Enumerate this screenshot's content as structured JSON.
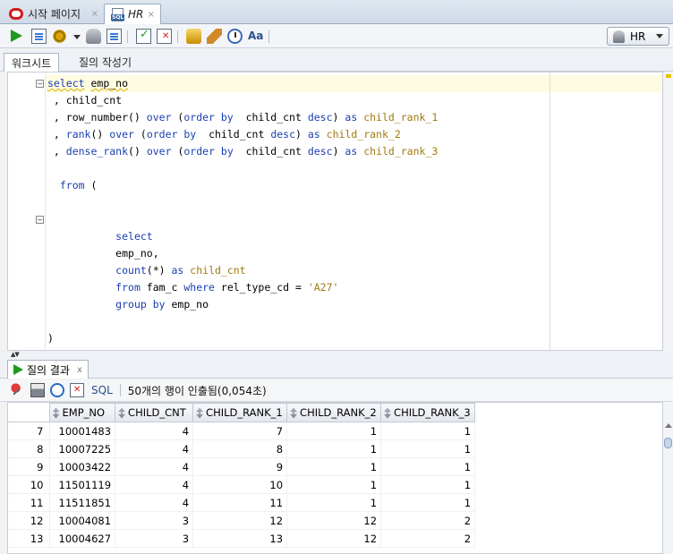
{
  "tabs": [
    {
      "label": "시작 페이지",
      "close": "×"
    },
    {
      "label": "HR",
      "close": "×"
    }
  ],
  "connection": {
    "label": "HR"
  },
  "subtabs": [
    "워크시트",
    "질의 작성기"
  ],
  "editor": {
    "lines": [
      [
        {
          "t": "select",
          "c": "kw squig"
        },
        {
          "t": " ",
          "c": "plain"
        },
        {
          "t": "emp_no",
          "c": "plain squig"
        }
      ],
      [
        {
          "t": " , child_cnt",
          "c": "plain"
        }
      ],
      [
        {
          "t": " , row_number() ",
          "c": "plain"
        },
        {
          "t": "over",
          "c": "kw"
        },
        {
          "t": " (",
          "c": "plain"
        },
        {
          "t": "order by",
          "c": "kw"
        },
        {
          "t": "  child_cnt ",
          "c": "plain"
        },
        {
          "t": "desc",
          "c": "kw"
        },
        {
          "t": ") ",
          "c": "plain"
        },
        {
          "t": "as",
          "c": "kw"
        },
        {
          "t": " ",
          "c": "plain"
        },
        {
          "t": "child_rank_1",
          "c": "id"
        }
      ],
      [
        {
          "t": " , ",
          "c": "plain"
        },
        {
          "t": "rank",
          "c": "kw"
        },
        {
          "t": "() ",
          "c": "plain"
        },
        {
          "t": "over",
          "c": "kw"
        },
        {
          "t": " (",
          "c": "plain"
        },
        {
          "t": "order by",
          "c": "kw"
        },
        {
          "t": "  child_cnt ",
          "c": "plain"
        },
        {
          "t": "desc",
          "c": "kw"
        },
        {
          "t": ") ",
          "c": "plain"
        },
        {
          "t": "as",
          "c": "kw"
        },
        {
          "t": " ",
          "c": "plain"
        },
        {
          "t": "child_rank_2",
          "c": "id"
        }
      ],
      [
        {
          "t": " , ",
          "c": "plain"
        },
        {
          "t": "dense_rank",
          "c": "kw"
        },
        {
          "t": "() ",
          "c": "plain"
        },
        {
          "t": "over",
          "c": "kw"
        },
        {
          "t": " (",
          "c": "plain"
        },
        {
          "t": "order by",
          "c": "kw"
        },
        {
          "t": "  child_cnt ",
          "c": "plain"
        },
        {
          "t": "desc",
          "c": "kw"
        },
        {
          "t": ") ",
          "c": "plain"
        },
        {
          "t": "as",
          "c": "kw"
        },
        {
          "t": " ",
          "c": "plain"
        },
        {
          "t": "child_rank_3",
          "c": "id"
        }
      ],
      [],
      [
        {
          "t": "  ",
          "c": "plain"
        },
        {
          "t": "from",
          "c": "kw"
        },
        {
          "t": " (",
          "c": "plain"
        }
      ],
      [],
      [],
      [
        {
          "t": "           ",
          "c": "plain"
        },
        {
          "t": "select",
          "c": "kw"
        }
      ],
      [
        {
          "t": "           emp_no,",
          "c": "plain"
        }
      ],
      [
        {
          "t": "           ",
          "c": "plain"
        },
        {
          "t": "count",
          "c": "kw"
        },
        {
          "t": "(*) ",
          "c": "plain"
        },
        {
          "t": "as",
          "c": "kw"
        },
        {
          "t": " ",
          "c": "plain"
        },
        {
          "t": "child_cnt",
          "c": "id"
        }
      ],
      [
        {
          "t": "           ",
          "c": "plain"
        },
        {
          "t": "from",
          "c": "kw"
        },
        {
          "t": " fam_c ",
          "c": "plain"
        },
        {
          "t": "where",
          "c": "kw"
        },
        {
          "t": " rel_type_cd = ",
          "c": "plain"
        },
        {
          "t": "'A27'",
          "c": "str"
        }
      ],
      [
        {
          "t": "           ",
          "c": "plain"
        },
        {
          "t": "group by",
          "c": "kw"
        },
        {
          "t": " emp_no",
          "c": "plain"
        }
      ],
      [],
      [
        {
          "t": ")",
          "c": "plain"
        }
      ],
      [
        {
          "t": ";",
          "c": "plain"
        }
      ]
    ]
  },
  "results": {
    "tab_label": "질의 결과",
    "tab_close": "x",
    "sql_label": "SQL",
    "status": "50개의 행이 인출됨(0,054초)",
    "columns": [
      "EMP_NO",
      "CHILD_CNT",
      "CHILD_RANK_1",
      "CHILD_RANK_2",
      "CHILD_RANK_3"
    ],
    "rows": [
      [
        "7",
        "10001483",
        "4",
        "7",
        "1",
        "1"
      ],
      [
        "8",
        "10007225",
        "4",
        "8",
        "1",
        "1"
      ],
      [
        "9",
        "10003422",
        "4",
        "9",
        "1",
        "1"
      ],
      [
        "10",
        "11501119",
        "4",
        "10",
        "1",
        "1"
      ],
      [
        "11",
        "11511851",
        "4",
        "11",
        "1",
        "1"
      ],
      [
        "12",
        "10004081",
        "3",
        "12",
        "12",
        "2"
      ],
      [
        "13",
        "10004627",
        "3",
        "13",
        "12",
        "2"
      ]
    ]
  }
}
